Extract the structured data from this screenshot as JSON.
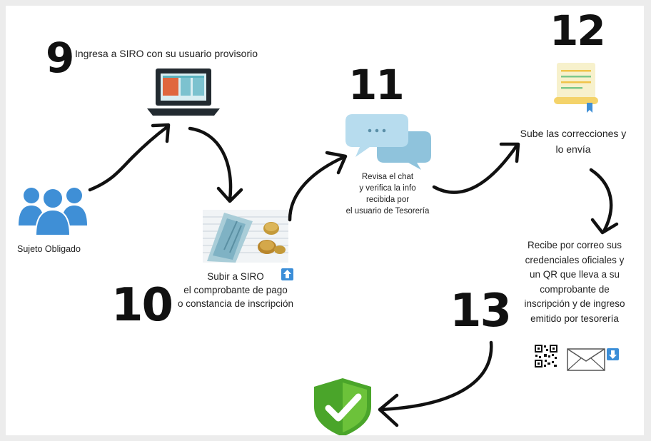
{
  "steps": [
    {
      "number": "9",
      "text": "Ingresa a SIRO con su usuario provisorio"
    },
    {
      "number": "10",
      "lines": [
        "Subir a SIRO",
        "el comprobante de pago",
        "o constancia de inscripción"
      ]
    },
    {
      "number": "11",
      "lines": [
        "Revisa el chat",
        "y verifica la info",
        "recibida por",
        "el usuario de Tesorería"
      ]
    },
    {
      "number": "12",
      "lines": [
        "Sube las correcciones y",
        "lo envía"
      ]
    },
    {
      "number": "13",
      "lines": [
        "Recibe por correo sus",
        "credenciales oficiales y",
        "un QR que lleva a su",
        "comprobante de",
        "inscripción y de ingreso",
        "emitido por tesorería"
      ]
    }
  ],
  "actor": {
    "label": "Sujeto Obligado"
  },
  "icons": {
    "actor": "users-group-icon",
    "laptop": "laptop-icon",
    "receipt": "receipt-with-coins-photo",
    "chat": "chat-bubbles-icon",
    "document": "certificate-document-icon",
    "qr": "qr-code-icon",
    "mail": "envelope-icon",
    "upload": "upload-arrow-icon",
    "download": "download-arrow-icon",
    "shield": "shield-check-icon"
  },
  "colors": {
    "actor_blue": "#3f8fd6",
    "chat_blue": "#9fd0e8",
    "badge_blue": "#3b8ed8",
    "shield_green": "#5cb82e",
    "laptop_dark": "#222a30",
    "screen_teal": "#5ab3c0"
  }
}
